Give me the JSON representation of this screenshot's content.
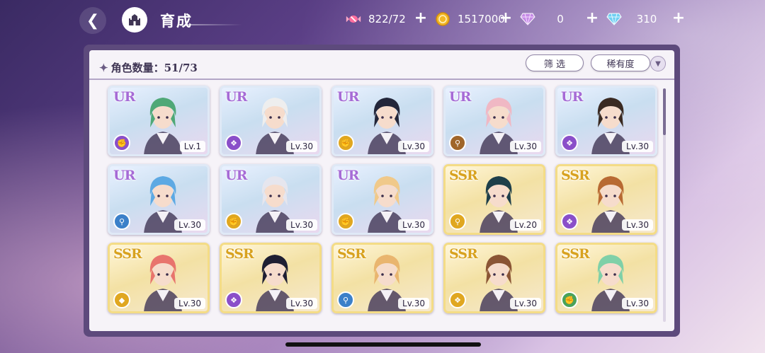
{
  "header": {
    "title": "育成",
    "currencies": [
      {
        "name": "candy",
        "value": "822/72",
        "icon": "candy-icon",
        "color": "#ff6fa0"
      },
      {
        "name": "coin",
        "value": "1517000",
        "icon": "coin-icon",
        "color": "#f2b827"
      },
      {
        "name": "pink-gem",
        "value": "0",
        "icon": "pink-diamond-icon",
        "color": "#c58ae6"
      },
      {
        "name": "blue-gem",
        "value": "310",
        "icon": "blue-diamond-icon",
        "color": "#6fcff2"
      }
    ]
  },
  "panel": {
    "count_label": "角色数量：",
    "count_value": "51/73",
    "filter_label": "筛 选",
    "rarity_label": "稀有度"
  },
  "cards": [
    {
      "rarity": "UR",
      "level": "Lv.1",
      "attr_color": "#8a4fc9",
      "hair": "#4fa877",
      "attr_icon": "fist-icon"
    },
    {
      "rarity": "UR",
      "level": "Lv.30",
      "attr_color": "#8a4fc9",
      "hair": "#eeeeee",
      "attr_icon": "book-icon"
    },
    {
      "rarity": "UR",
      "level": "Lv.30",
      "attr_color": "#e0a720",
      "hair": "#23263a",
      "attr_icon": "fist-icon"
    },
    {
      "rarity": "UR",
      "level": "Lv.30",
      "attr_color": "#a0662a",
      "hair": "#f0b8c4",
      "attr_icon": "key-icon"
    },
    {
      "rarity": "UR",
      "level": "Lv.30",
      "attr_color": "#8a4fc9",
      "hair": "#3a2a22",
      "attr_icon": "book-icon"
    },
    {
      "rarity": "UR",
      "level": "Lv.30",
      "attr_color": "#3b80c9",
      "hair": "#5da9e3",
      "attr_icon": "key-icon"
    },
    {
      "rarity": "UR",
      "level": "Lv.30",
      "attr_color": "#e0a720",
      "hair": "#e6e6ee",
      "attr_icon": "fist-icon"
    },
    {
      "rarity": "UR",
      "level": "Lv.30",
      "attr_color": "#e0a720",
      "hair": "#f0c98a",
      "attr_icon": "fist-icon"
    },
    {
      "rarity": "SSR",
      "level": "Lv.20",
      "attr_color": "#e0a720",
      "hair": "#1e3f4a",
      "attr_icon": "key-icon"
    },
    {
      "rarity": "SSR",
      "level": "Lv.30",
      "attr_color": "#8a4fc9",
      "hair": "#b86a33",
      "attr_icon": "book-icon"
    },
    {
      "rarity": "SSR",
      "level": "Lv.30",
      "attr_color": "#e0a720",
      "hair": "#e8746d",
      "attr_icon": "shield-icon"
    },
    {
      "rarity": "SSR",
      "level": "Lv.30",
      "attr_color": "#8a4fc9",
      "hair": "#1f1f33",
      "attr_icon": "book-icon"
    },
    {
      "rarity": "SSR",
      "level": "Lv.30",
      "attr_color": "#3b80c9",
      "hair": "#e9b56f",
      "attr_icon": "key-icon"
    },
    {
      "rarity": "SSR",
      "level": "Lv.30",
      "attr_color": "#e0a720",
      "hair": "#8a5535",
      "attr_icon": "book-icon"
    },
    {
      "rarity": "SSR",
      "level": "Lv.30",
      "attr_color": "#4aa35a",
      "hair": "#7fd0a8",
      "attr_icon": "fist-icon"
    }
  ]
}
